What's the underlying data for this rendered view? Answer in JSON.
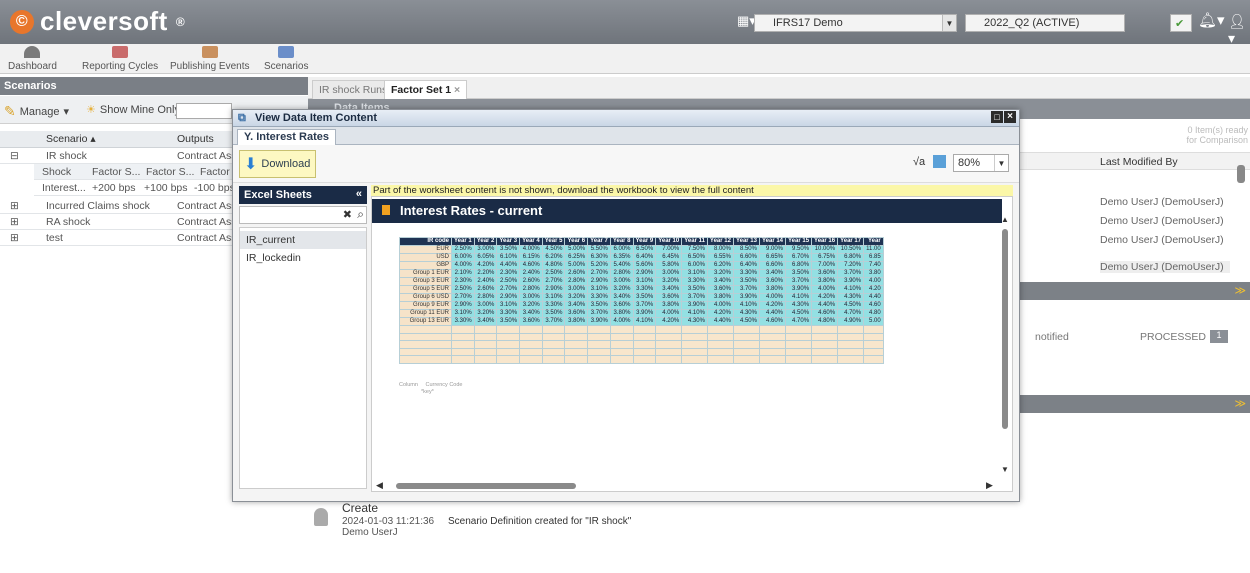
{
  "app": {
    "brand": "cleversoft",
    "brand_mark": "®"
  },
  "header": {
    "environment": "IFRS17 Demo",
    "period": "2022_Q2 (ACTIVE)"
  },
  "nav": [
    {
      "label": "Dashboard",
      "icon": "dashboard-icon"
    },
    {
      "label": "Reporting Cycles",
      "icon": "calendar-icon"
    },
    {
      "label": "Publishing Events",
      "icon": "publish-icon"
    },
    {
      "label": "Scenarios",
      "icon": "scenarios-icon"
    }
  ],
  "left_panel": {
    "title": "Scenarios",
    "manage_label": "Manage",
    "show_mine_label": "Show Mine Only",
    "columns": [
      "Scenario",
      "Outputs"
    ],
    "sub_columns": [
      "Shock",
      "Factor S...",
      "Factor S...",
      "Factor S"
    ],
    "rows": [
      {
        "name": "IR shock",
        "output": "Contract Asse"
      },
      {
        "name": "Incurred Claims shock",
        "output": "Contract Asse"
      },
      {
        "name": "RA shock",
        "output": "Contract Asse"
      },
      {
        "name": "test",
        "output": "Contract Asse"
      }
    ],
    "sub_row": [
      "Interest...",
      "+200 bps",
      "+100 bps",
      "-100 bps"
    ]
  },
  "right_panel": {
    "tabs": [
      "IR shock Runs",
      "Factor Set 1"
    ],
    "header_partial": "Data Items",
    "items_ready": "0 Item(s) ready",
    "for_comparison": "for Comparison",
    "last_modified_header": "Last Modified By",
    "modified_by": [
      "Demo UserJ (DemoUserJ)",
      "Demo UserJ (DemoUserJ)",
      "Demo UserJ (DemoUserJ)",
      "Demo UserJ (DemoUserJ)"
    ],
    "notified": "notified",
    "status": "PROCESSED",
    "status_count": "1"
  },
  "modal": {
    "title": "View Data Item Content",
    "tab": "Y. Interest Rates",
    "download_label": "Download",
    "zoom": "80%",
    "sheets_title": "Excel Sheets",
    "sheets": [
      "IR_current",
      "IR_lockedin"
    ],
    "warning": "Part of the worksheet content is not shown, download the workbook to view the full content",
    "worksheet_title": "Interest Rates - current",
    "table": {
      "headers": [
        "IR code",
        "Year 1",
        "Year 2",
        "Year 3",
        "Year 4",
        "Year 5",
        "Year 6",
        "Year 7",
        "Year 8",
        "Year 9",
        "Year 10",
        "Year 11",
        "Year 12",
        "Year 13",
        "Year 14",
        "Year 15",
        "Year 16",
        "Year 17",
        "Year"
      ],
      "rows": [
        [
          "EUR",
          "2.50%",
          "3.00%",
          "3.50%",
          "4.00%",
          "4.50%",
          "5.00%",
          "5.50%",
          "6.00%",
          "6.50%",
          "7.00%",
          "7.50%",
          "8.00%",
          "8.50%",
          "9.00%",
          "9.50%",
          "10.00%",
          "10.50%",
          "11.00"
        ],
        [
          "USD",
          "6.00%",
          "6.05%",
          "6.10%",
          "6.15%",
          "6.20%",
          "6.25%",
          "6.30%",
          "6.35%",
          "6.40%",
          "6.45%",
          "6.50%",
          "6.55%",
          "6.60%",
          "6.65%",
          "6.70%",
          "6.75%",
          "6.80%",
          "6.85"
        ],
        [
          "GBP",
          "4.00%",
          "4.20%",
          "4.40%",
          "4.60%",
          "4.80%",
          "5.00%",
          "5.20%",
          "5.40%",
          "5.60%",
          "5.80%",
          "6.00%",
          "6.20%",
          "6.40%",
          "6.60%",
          "6.80%",
          "7.00%",
          "7.20%",
          "7.40"
        ],
        [
          "Group 1 EUR",
          "2.10%",
          "2.20%",
          "2.30%",
          "2.40%",
          "2.50%",
          "2.60%",
          "2.70%",
          "2.80%",
          "2.90%",
          "3.00%",
          "3.10%",
          "3.20%",
          "3.30%",
          "3.40%",
          "3.50%",
          "3.60%",
          "3.70%",
          "3.80"
        ],
        [
          "Group 3 EUR",
          "2.30%",
          "2.40%",
          "2.50%",
          "2.60%",
          "2.70%",
          "2.80%",
          "2.90%",
          "3.00%",
          "3.10%",
          "3.20%",
          "3.30%",
          "3.40%",
          "3.50%",
          "3.60%",
          "3.70%",
          "3.80%",
          "3.90%",
          "4.00"
        ],
        [
          "Group 5 EUR",
          "2.50%",
          "2.60%",
          "2.70%",
          "2.80%",
          "2.90%",
          "3.00%",
          "3.10%",
          "3.20%",
          "3.30%",
          "3.40%",
          "3.50%",
          "3.60%",
          "3.70%",
          "3.80%",
          "3.90%",
          "4.00%",
          "4.10%",
          "4.20"
        ],
        [
          "Group 6 USD",
          "2.70%",
          "2.80%",
          "2.90%",
          "3.00%",
          "3.10%",
          "3.20%",
          "3.30%",
          "3.40%",
          "3.50%",
          "3.60%",
          "3.70%",
          "3.80%",
          "3.90%",
          "4.00%",
          "4.10%",
          "4.20%",
          "4.30%",
          "4.40"
        ],
        [
          "Group 9 EUR",
          "2.90%",
          "3.00%",
          "3.10%",
          "3.20%",
          "3.30%",
          "3.40%",
          "3.50%",
          "3.60%",
          "3.70%",
          "3.80%",
          "3.90%",
          "4.00%",
          "4.10%",
          "4.20%",
          "4.30%",
          "4.40%",
          "4.50%",
          "4.60"
        ],
        [
          "Group 11 EUR",
          "3.10%",
          "3.20%",
          "3.30%",
          "3.40%",
          "3.50%",
          "3.60%",
          "3.70%",
          "3.80%",
          "3.90%",
          "4.00%",
          "4.10%",
          "4.20%",
          "4.30%",
          "4.40%",
          "4.50%",
          "4.60%",
          "4.70%",
          "4.80"
        ],
        [
          "Group 13 EUR",
          "3.30%",
          "3.40%",
          "3.50%",
          "3.60%",
          "3.70%",
          "3.80%",
          "3.90%",
          "4.00%",
          "4.10%",
          "4.20%",
          "4.30%",
          "4.40%",
          "4.50%",
          "4.60%",
          "4.70%",
          "4.80%",
          "4.90%",
          "5.00"
        ]
      ]
    },
    "meta_label": "Column",
    "meta_code": "Currency Code",
    "meta_key": "*key*"
  },
  "activity": {
    "title": "Create",
    "timestamp": "2024-01-03 11:21:36",
    "user": "Demo UserJ",
    "message": "Scenario Definition created for \"IR shock\""
  },
  "colors": {
    "brand_orange": "#e8762b",
    "navy": "#1a2b46",
    "cell_teal": "#93e0e3",
    "cell_sand": "#f6e3c9",
    "warning_yellow": "#fbf7a8"
  }
}
